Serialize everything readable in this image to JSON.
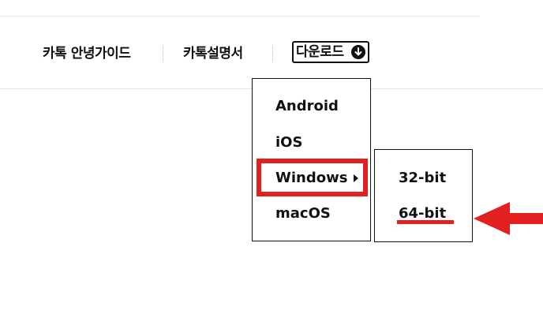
{
  "nav": {
    "items": [
      {
        "label": "카톡 안녕가이드"
      },
      {
        "label": "카톡설명서"
      }
    ],
    "download": {
      "label": "다운로드",
      "icon": "arrow-down-circle-icon"
    }
  },
  "download_menu": {
    "items": [
      {
        "label": "Android"
      },
      {
        "label": "iOS"
      },
      {
        "label": "Windows",
        "has_submenu": true,
        "highlighted": true
      },
      {
        "label": "macOS"
      }
    ]
  },
  "windows_submenu": {
    "items": [
      {
        "label": "32-bit"
      },
      {
        "label": "64-bit",
        "highlighted": true
      }
    ]
  },
  "annotation": {
    "color": "#e32020",
    "icon": "left-arrow-icon"
  }
}
